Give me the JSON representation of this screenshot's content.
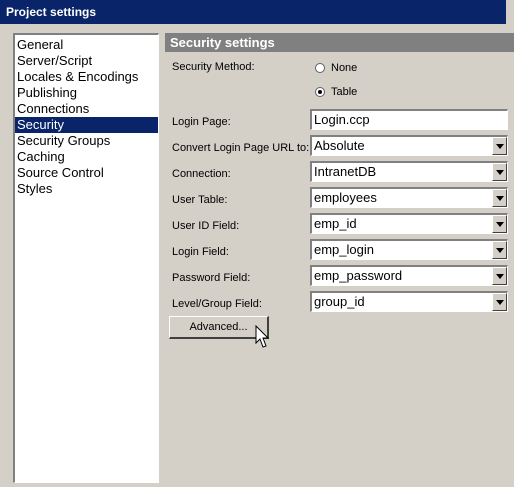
{
  "window": {
    "title": "Project settings"
  },
  "nav": {
    "items": [
      {
        "label": "General"
      },
      {
        "label": "Server/Script"
      },
      {
        "label": "Locales & Encodings"
      },
      {
        "label": "Publishing"
      },
      {
        "label": "Connections"
      },
      {
        "label": "Security"
      },
      {
        "label": "Security Groups"
      },
      {
        "label": "Caching"
      },
      {
        "label": "Source Control"
      },
      {
        "label": "Styles"
      }
    ],
    "selected": "Security"
  },
  "panel": {
    "title": "Security settings",
    "security_method": {
      "label": "Security Method:",
      "options": [
        {
          "label": "None",
          "checked": false
        },
        {
          "label": "Table",
          "checked": true
        }
      ]
    },
    "login_page": {
      "label": "Login Page:",
      "value": "Login.ccp"
    },
    "convert_url": {
      "label": "Convert Login Page URL to:",
      "value": "Absolute"
    },
    "connection": {
      "label": "Connection:",
      "value": "IntranetDB"
    },
    "user_table": {
      "label": "User Table:",
      "value": "employees"
    },
    "user_id_field": {
      "label": "User ID Field:",
      "value": "emp_id"
    },
    "login_field": {
      "label": "Login Field:",
      "value": "emp_login"
    },
    "password_field": {
      "label": "Password Field:",
      "value": "emp_password"
    },
    "level_group_field": {
      "label": "Level/Group Field:",
      "value": "group_id"
    },
    "advanced_button": {
      "label": "Advanced..."
    }
  }
}
